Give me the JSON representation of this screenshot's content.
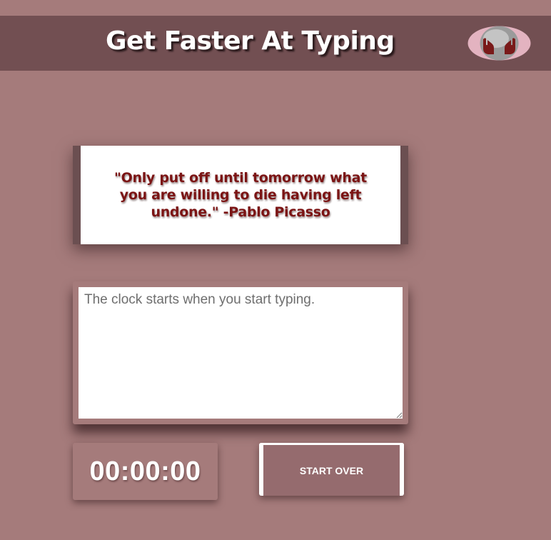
{
  "header": {
    "title": "Get Faster At Typing",
    "logo_icon": "hands-globe-icon"
  },
  "quote": {
    "text": "\"Only put off until tomorrow what you are willing to die having left undone.\" -Pablo Picasso"
  },
  "typing": {
    "value": "",
    "placeholder": "The clock starts when you start typing."
  },
  "timer": {
    "display": "00:00:00"
  },
  "controls": {
    "start_over_label": "START OVER"
  },
  "colors": {
    "background": "#a57b7b",
    "header": "#724f52",
    "quote_text": "#7b1414",
    "button": "#956b6e"
  }
}
